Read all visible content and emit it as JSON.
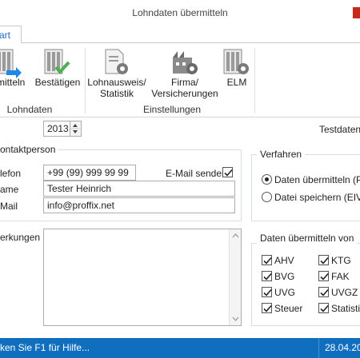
{
  "window": {
    "title": "Lohndaten übermitteln"
  },
  "tabs": [
    {
      "label": "art"
    }
  ],
  "ribbon": {
    "groups": [
      {
        "label": "Lohndaten",
        "buttons": [
          {
            "label": "mitteln",
            "icon": "transmit-icon"
          },
          {
            "label": "Bestätigen",
            "icon": "confirm-icon"
          }
        ]
      },
      {
        "label": "Einstellungen",
        "buttons": [
          {
            "label_line1": "Lohnausweis/",
            "label_line2": "Statistik",
            "icon": "settings-gear-icon"
          },
          {
            "label_line1": "Firma/",
            "label_line2": "Versicherungen",
            "icon": "building-gear-icon"
          },
          {
            "label": "ELM",
            "icon": "elm-gear-icon"
          }
        ]
      }
    ]
  },
  "form": {
    "year": "2013",
    "testdaten_label": "Testdaten"
  },
  "kontaktperson": {
    "legend": "ontaktperson",
    "telefon_label": "lefon",
    "telefon_value": "+99 (99) 999 99 99",
    "email_senden_label": "E-Mail senden",
    "email_senden_checked": true,
    "name_label": "ame",
    "name_value": "Tester Heinrich",
    "email_label": "Mail",
    "email_value": "info@proffix.net"
  },
  "bemerkungen": {
    "label": "erkungen",
    "value": ""
  },
  "verfahren": {
    "legend": "Verfahren",
    "options": [
      {
        "label": "Daten übermitteln (PIV",
        "selected": true
      },
      {
        "label": "Datei speichern (EIV)",
        "selected": false
      }
    ]
  },
  "daten_uebermitteln": {
    "legend": "Daten übermitteln von",
    "left": [
      {
        "label": "AHV",
        "checked": true
      },
      {
        "label": "BVG",
        "checked": true
      },
      {
        "label": "UVG",
        "checked": true
      },
      {
        "label": "Steuer",
        "checked": true
      }
    ],
    "right": [
      {
        "label": "KTG",
        "checked": true
      },
      {
        "label": "FAK",
        "checked": true
      },
      {
        "label": "UVGZ",
        "checked": true
      },
      {
        "label": "Statistik",
        "checked": true
      }
    ]
  },
  "status": {
    "hint": "ken Sie F1 für Hilfe...",
    "date": "28.04.20"
  },
  "colors": {
    "accent": "#0f6ebd",
    "tab_text": "#1c6fbf",
    "close": "#c42b1c",
    "icon_green": "#4caf50",
    "icon_blue": "#1e88e5"
  }
}
